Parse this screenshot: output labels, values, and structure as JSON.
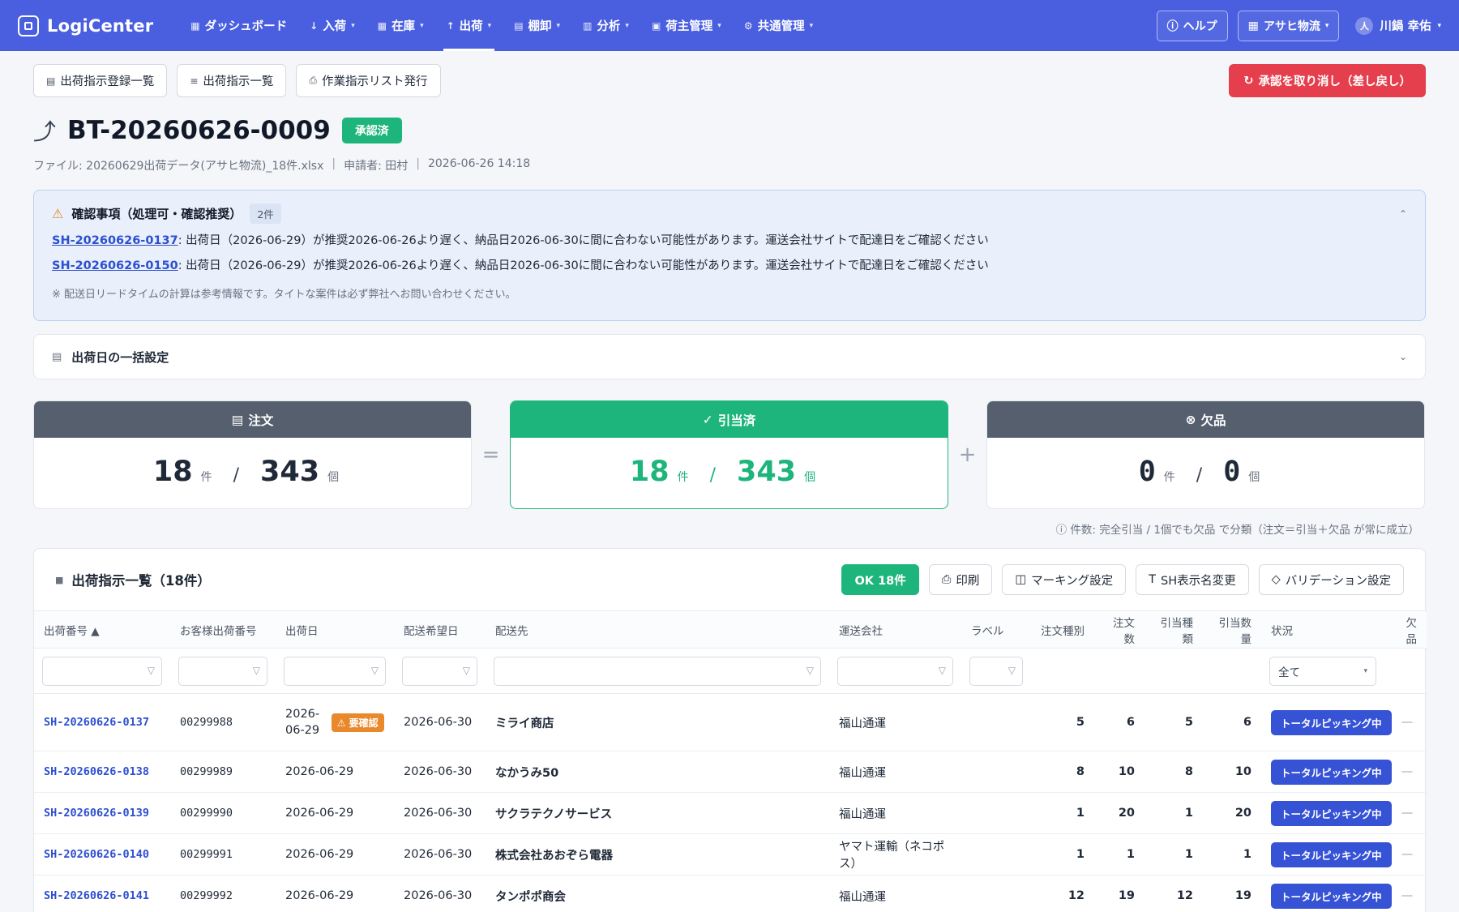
{
  "app": {
    "brand": "LogiCenter",
    "nav": [
      {
        "icon": "▦",
        "label": "ダッシュボード",
        "caret": false
      },
      {
        "icon": "↓",
        "label": "入荷",
        "caret": true
      },
      {
        "icon": "▦",
        "label": "在庫",
        "caret": true
      },
      {
        "icon": "↑",
        "label": "出荷",
        "caret": true
      },
      {
        "icon": "▤",
        "label": "棚卸",
        "caret": true
      },
      {
        "icon": "▥",
        "label": "分析",
        "caret": true
      },
      {
        "icon": "▣",
        "label": "荷主管理",
        "caret": true
      },
      {
        "icon": "⚙",
        "label": "共通管理",
        "caret": true
      }
    ],
    "help": "ヘルプ",
    "client": "アサヒ物流",
    "user": "川鍋 幸佑"
  },
  "actions": {
    "list_register": "出荷指示登録一覧",
    "list_instructions": "出荷指示一覧",
    "issue_worklist": "作業指示リスト発行",
    "revoke": "承認を取り消し（差し戻し）"
  },
  "title": {
    "batch_id": "BT-20260626-0009",
    "status": "承認済",
    "file": "ファイル: 20260629出荷データ(アサヒ物流)_18件.xlsx",
    "applicant": "申請者: 田村",
    "datetime": "2026-06-26 14:18"
  },
  "notice": {
    "title": "確認事項（処理可・確認推奨）",
    "count": "2件",
    "items": [
      {
        "link": "SH-20260626-0137",
        "text": ": 出荷日（2026-06-29）が推奨2026-06-26より遅く、納品日2026-06-30に間に合わない可能性があります。運送会社サイトで配達日をご確認ください"
      },
      {
        "link": "SH-20260626-0150",
        "text": ": 出荷日（2026-06-29）が推奨2026-06-26より遅く、納品日2026-06-30に間に合わない可能性があります。運送会社サイトで配達日をご確認ください"
      }
    ],
    "footnote": "※ 配送日リードタイムの計算は参考情報です。タイトな案件は必ず弊社へお問い合わせください。"
  },
  "bulk": {
    "title": "出荷日の一括設定"
  },
  "summary": {
    "order": {
      "label": "注文",
      "count": "18",
      "count_unit": "件",
      "qty": "343",
      "qty_unit": "個"
    },
    "allocated": {
      "label": "引当済",
      "count": "18",
      "count_unit": "件",
      "qty": "343",
      "qty_unit": "個"
    },
    "shortage": {
      "label": "欠品",
      "count": "0",
      "count_unit": "件",
      "qty": "0",
      "qty_unit": "個"
    },
    "op_equal": "=",
    "op_plus": "+",
    "note": "ⓘ 件数: 完全引当 / 1個でも欠品 で分類（注文＝引当＋欠品 が常に成立）"
  },
  "table": {
    "title": "出荷指示一覧（18件）",
    "ok": "OK 18件",
    "print": "印刷",
    "marking": "マーキング設定",
    "rename": "SH表示名変更",
    "validation": "バリデーション設定",
    "columns": [
      "出荷番号 ▲",
      "お客様出荷番号",
      "出荷日",
      "配送希望日",
      "配送先",
      "運送会社",
      "ラベル",
      "注文種別",
      "注文数",
      "引当種類",
      "引当数量",
      "状況",
      "欠品"
    ],
    "status_filter": "全て",
    "warn_label": "⚠ 要確認",
    "rows": [
      {
        "id": "SH-20260626-0137",
        "cust": "00299988",
        "ship": "2026-06-29",
        "ship_a": "2026-",
        "ship_b": "06-29",
        "due": "2026-06-30",
        "dest": "ミライ商店",
        "carrier": "福山通運",
        "label": "",
        "t1": "5",
        "n1": "6",
        "t2": "5",
        "n2": "6",
        "state": "トータルピッキング中",
        "short": "—"
      },
      {
        "id": "SH-20260626-0138",
        "cust": "00299989",
        "ship": "2026-06-29",
        "due": "2026-06-30",
        "dest": "なかうみ50",
        "carrier": "福山通運",
        "label": "",
        "t1": "8",
        "n1": "10",
        "t2": "8",
        "n2": "10",
        "state": "トータルピッキング中",
        "short": "—"
      },
      {
        "id": "SH-20260626-0139",
        "cust": "00299990",
        "ship": "2026-06-29",
        "due": "2026-06-30",
        "dest": "サクラテクノサービス",
        "carrier": "福山通運",
        "label": "",
        "t1": "1",
        "n1": "20",
        "t2": "1",
        "n2": "20",
        "state": "トータルピッキング中",
        "short": "—"
      },
      {
        "id": "SH-20260626-0140",
        "cust": "00299991",
        "ship": "2026-06-29",
        "due": "2026-06-30",
        "dest": "株式会社あおぞら電器",
        "carrier": "ヤマト運輸（ネコポス）",
        "label": "",
        "t1": "1",
        "n1": "1",
        "t2": "1",
        "n2": "1",
        "state": "トータルピッキング中",
        "short": "—"
      },
      {
        "id": "SH-20260626-0141",
        "cust": "00299992",
        "ship": "2026-06-29",
        "due": "2026-06-30",
        "dest": "タンポポ商会",
        "carrier": "福山通運",
        "label": "",
        "t1": "12",
        "n1": "19",
        "t2": "12",
        "n2": "19",
        "state": "トータルピッキング中",
        "short": "—"
      }
    ]
  },
  "colors": {
    "nav": "#4a5fe0",
    "success": "#1eb57c",
    "danger": "#e53e4c",
    "state": "#3653d6",
    "warn": "#e9892c",
    "card_head_gray": "#555f6e"
  }
}
